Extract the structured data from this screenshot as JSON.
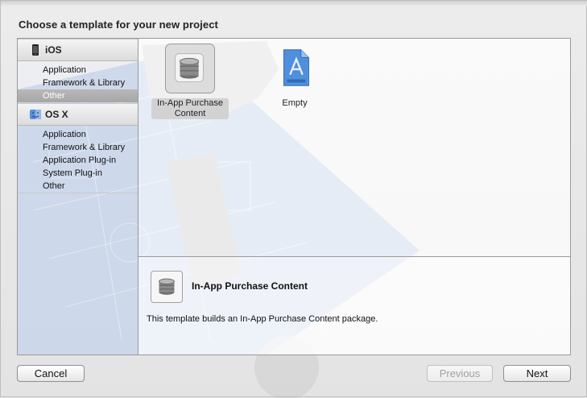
{
  "dialog": {
    "title": "Choose a template for your new project"
  },
  "sidebar": {
    "sections": [
      {
        "label": "iOS",
        "icon": "iphone-icon",
        "items": [
          "Application",
          "Framework & Library",
          "Other"
        ]
      },
      {
        "label": "OS X",
        "icon": "finder-icon",
        "items": [
          "Application",
          "Framework & Library",
          "Application Plug-in",
          "System Plug-in",
          "Other"
        ]
      }
    ],
    "selected": "iOS / Other"
  },
  "templates": [
    {
      "label_line1": "In-App Purchase",
      "label_line2": "Content",
      "icon": "coin-stack-icon",
      "selected": true
    },
    {
      "label_line1": "Empty",
      "label_line2": "",
      "icon": "blank-document-icon",
      "selected": false
    }
  ],
  "description": {
    "title": "In-App Purchase Content",
    "text": "This template builds an In-App Purchase Content package.",
    "icon": "coin-stack-icon"
  },
  "buttons": {
    "cancel": "Cancel",
    "previous": "Previous",
    "next": "Next"
  },
  "colors": {
    "selection": "#aaaaaa",
    "blueprint": "#4a82c8"
  }
}
